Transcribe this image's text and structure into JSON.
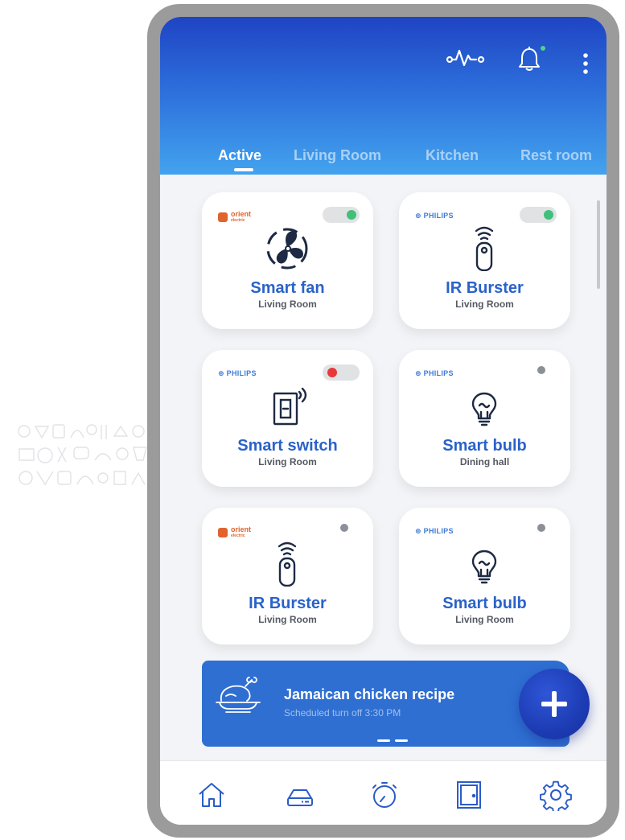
{
  "header": {
    "icons": [
      "pulse-icon",
      "bell-icon",
      "more-vert-icon"
    ],
    "notification_dot": true
  },
  "tabs": [
    {
      "label": "Active",
      "active": true
    },
    {
      "label": "Living Room",
      "active": false
    },
    {
      "label": "Kitchen",
      "active": false
    },
    {
      "label": "Rest room",
      "active": false
    }
  ],
  "devices": [
    {
      "brand": "orient",
      "brand_label": "orient",
      "brand_sub": "electric",
      "icon": "fan-icon",
      "title": "Smart fan",
      "room": "Living Room",
      "status": "toggle-on"
    },
    {
      "brand": "philips",
      "brand_label": "PHILIPS",
      "icon": "remote-icon",
      "title": "IR Burster",
      "room": "Living Room",
      "status": "toggle-on"
    },
    {
      "brand": "philips",
      "brand_label": "PHILIPS",
      "icon": "switch-icon",
      "title": "Smart switch",
      "room": "Living Room",
      "status": "toggle-off"
    },
    {
      "brand": "philips",
      "brand_label": "PHILIPS",
      "icon": "bulb-icon",
      "title": "Smart bulb",
      "room": "Dining hall",
      "status": "offline"
    },
    {
      "brand": "orient",
      "brand_label": "orient",
      "brand_sub": "electric",
      "icon": "remote-icon",
      "title": "IR Burster",
      "room": "Living Room",
      "status": "offline"
    },
    {
      "brand": "philips",
      "brand_label": "PHILIPS",
      "icon": "bulb-icon",
      "title": "Smart bulb",
      "room": "Living Room",
      "status": "offline"
    }
  ],
  "banner": {
    "title": "Jamaican chicken recipe",
    "subtitle": "Scheduled turn off 3:30 PM",
    "icon": "roast-chicken-icon"
  },
  "fab": {
    "label": "+",
    "icon": "plus-icon"
  },
  "bottom_nav": [
    "home-icon",
    "router-icon",
    "timer-icon",
    "door-icon",
    "settings-icon"
  ],
  "colors": {
    "header_top": "#1f44c3",
    "header_bottom": "#43a3ee",
    "accent": "#2a62c9",
    "toggle_on": "#3fc07a",
    "toggle_off": "#e63939",
    "offline": "#8b8f97",
    "banner": "#2f6fd2"
  }
}
